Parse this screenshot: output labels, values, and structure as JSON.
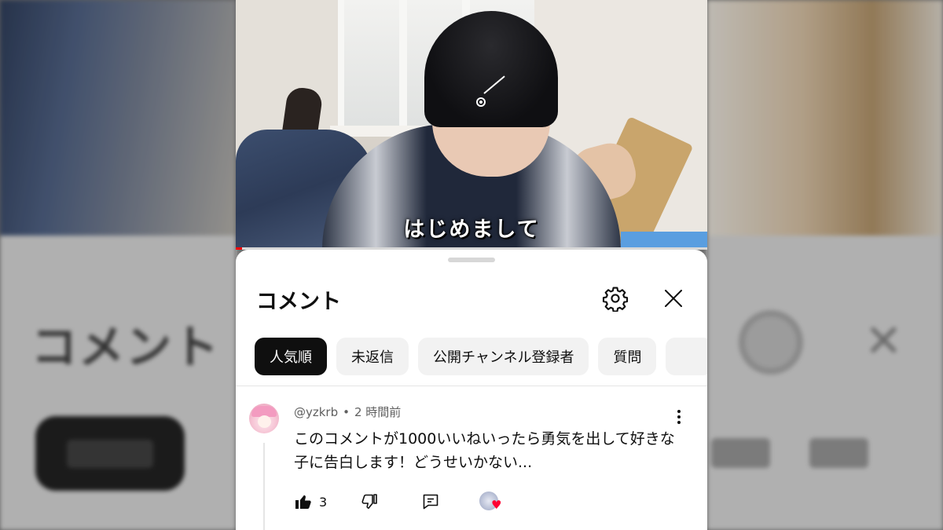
{
  "video": {
    "subtitle": "はじめまして",
    "progress_color": "#ff0000"
  },
  "comments_panel": {
    "title": "コメント",
    "settings_icon": "gear-icon",
    "close_icon": "close-icon",
    "filters": [
      {
        "label": "人気順",
        "active": true
      },
      {
        "label": "未返信",
        "active": false
      },
      {
        "label": "公開チャンネル登録者",
        "active": false
      },
      {
        "label": "質問",
        "active": false
      }
    ]
  },
  "comment": {
    "author": "@yzkrb",
    "separator": "•",
    "time": "2 時間前",
    "text": "このコメントが1000いいねいったら勇気を出して好きな子に告白します！どうせいかない...",
    "like_count": "3",
    "icons": {
      "like": "thumbs-up-icon",
      "dislike": "thumbs-down-icon",
      "reply": "reply-icon",
      "more": "more-vertical-icon",
      "creator_heart": "creator-heart-icon"
    }
  },
  "background": {
    "title": "コメント"
  }
}
